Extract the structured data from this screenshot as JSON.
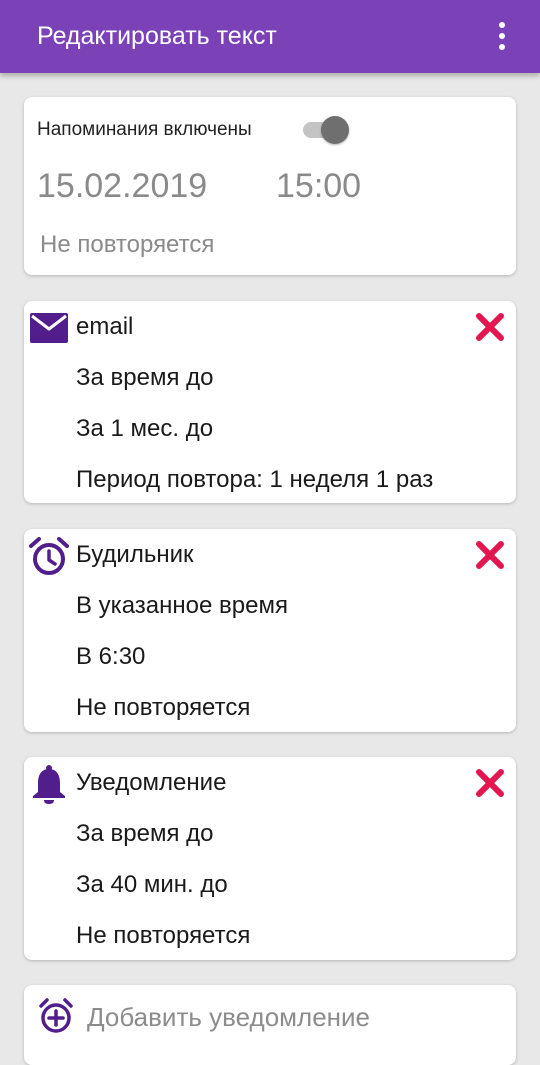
{
  "colors": {
    "accent": "#7b42b8",
    "icon_purple": "#521e8c",
    "delete_red": "#e3174f",
    "muted_text": "#8a8a8a"
  },
  "header": {
    "title": "Редактировать текст",
    "menu_icon": "more-vert-icon"
  },
  "reminder": {
    "label": "Напоминания включены",
    "enabled": true,
    "date": "15.02.2019",
    "time": "15:00",
    "repeat": "Не повторяется"
  },
  "notifications": [
    {
      "icon": "email-icon",
      "title": "email",
      "line1": "За время до",
      "line2": "За 1 мес. до",
      "line3": "Период повтора: 1 неделя 1 раз"
    },
    {
      "icon": "alarm-icon",
      "title": "Будильник",
      "line1": "В указанное время",
      "line2": "В 6:30",
      "line3": "Не повторяется"
    },
    {
      "icon": "bell-icon",
      "title": "Уведомление",
      "line1": "За время до",
      "line2": "За 40 мин. до",
      "line3": "Не повторяется"
    }
  ],
  "add": {
    "icon": "alarm-add-icon",
    "label": "Добавить уведомление"
  }
}
